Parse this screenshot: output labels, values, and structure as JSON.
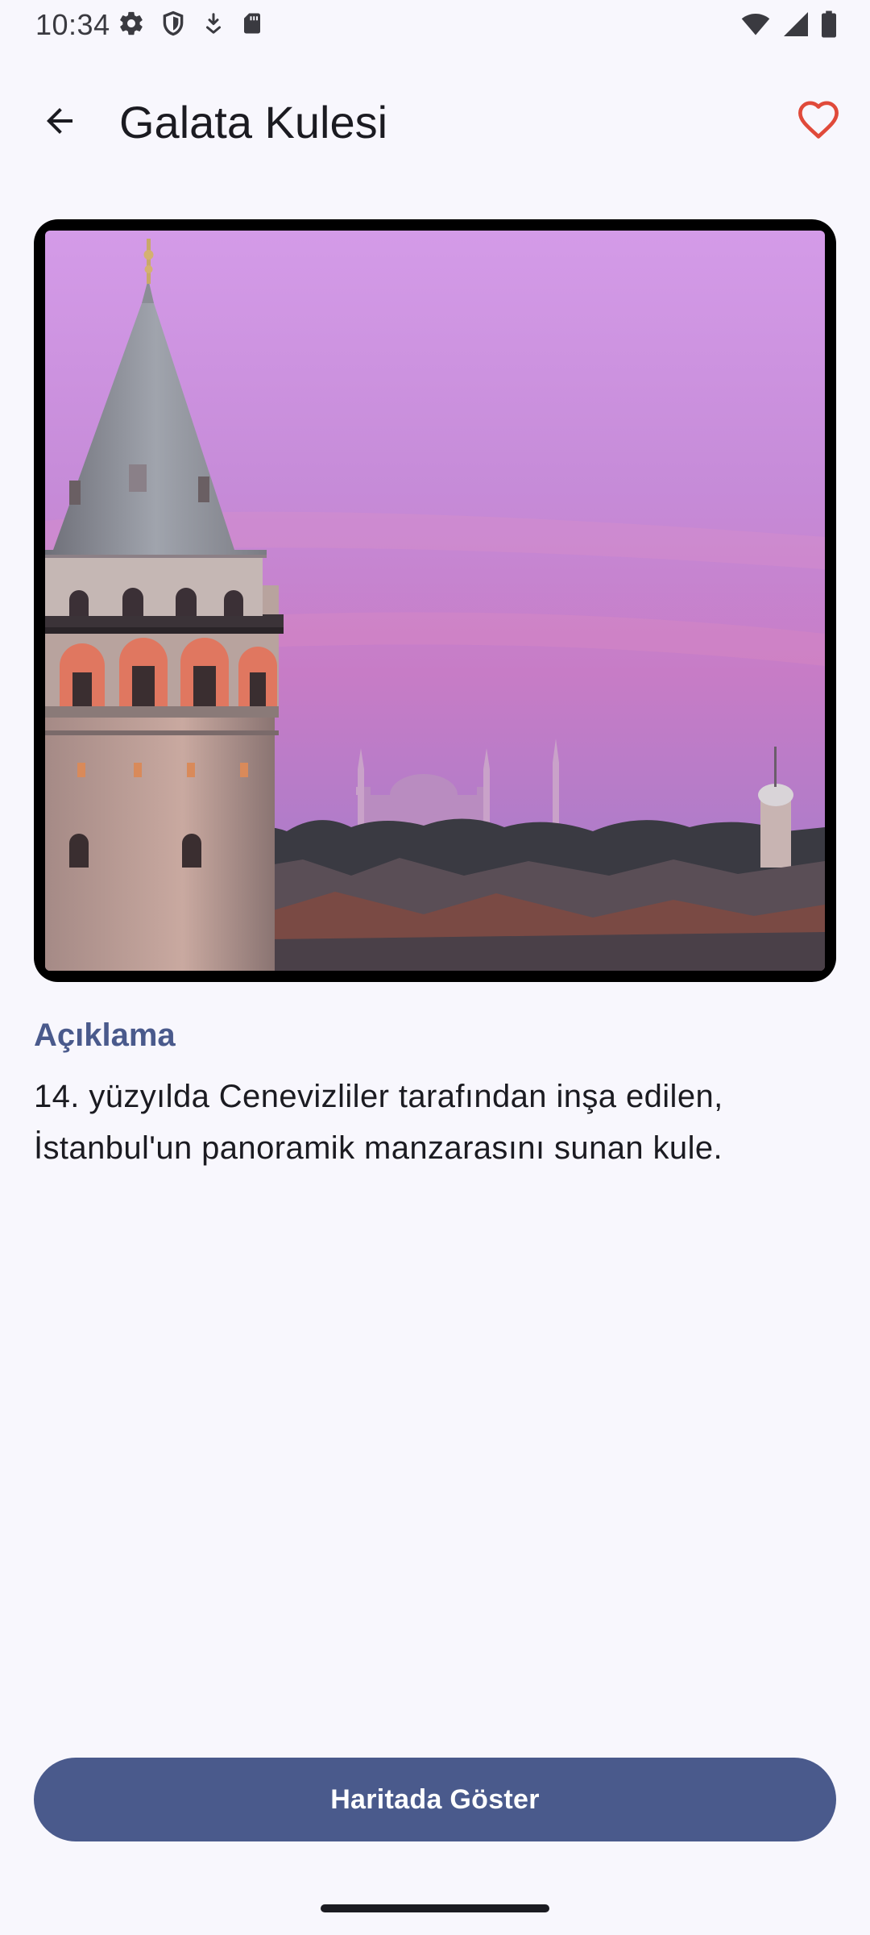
{
  "status_bar": {
    "time": "10:34",
    "left_icons": [
      "settings-icon",
      "shield-icon",
      "download-icon",
      "sd-card-icon"
    ],
    "right_icons": [
      "wifi-icon",
      "cell-signal-icon",
      "battery-icon"
    ]
  },
  "top_bar": {
    "title": "Galata Kulesi",
    "back_icon": "arrow-back-icon",
    "favorite_icon": "heart-outline-icon",
    "favorite_color": "#e04a3a"
  },
  "hero": {
    "image_subject": "Galata Tower at sunset with Istanbul skyline"
  },
  "description": {
    "heading": "Açıklama",
    "text": "14. yüzyılda Cenevizliler tarafından inşa edilen, İstanbul'un panoramik manzarasını sunan kule."
  },
  "actions": {
    "map_button_label": "Haritada Göster"
  },
  "colors": {
    "background": "#f8f7fd",
    "primary": "#4a5a8c",
    "on_primary": "#ffffff",
    "text": "#1b1b21"
  }
}
